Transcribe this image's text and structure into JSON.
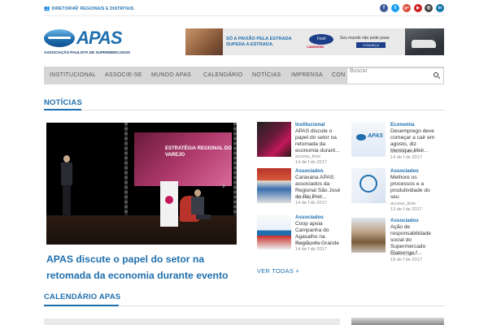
{
  "topbar": {
    "links": [
      {
        "label": "DIRETORIA",
        "icon": "people-icon"
      },
      {
        "label": "REGIONAIS E DISTRITAIS",
        "icon": "pin-icon"
      }
    ],
    "social": [
      {
        "glyph": "f",
        "icon": "facebook-icon",
        "color": "#3b5998"
      },
      {
        "glyph": "t",
        "icon": "twitter-icon",
        "color": "#1da1f2"
      },
      {
        "glyph": "g+",
        "icon": "googleplus-icon",
        "color": "#dd4b39"
      },
      {
        "glyph": "▶",
        "icon": "youtube-icon",
        "color": "#cd201f"
      },
      {
        "glyph": "◎",
        "icon": "instagram-icon",
        "color": "#3f3f3f"
      },
      {
        "glyph": "in",
        "icon": "linkedin-icon",
        "color": "#0e76a8"
      }
    ]
  },
  "logo": {
    "word": "APAS",
    "subtitle": "ASSOCIAÇÃO PAULISTA DE SUPERMERCADOS"
  },
  "banner": {
    "slogan": "SÓ A PAIXÃO PELA ESTRADA SUPERA A ESTRADA.",
    "ford": "Ford",
    "brand": "CAMINHÕES",
    "tagline": "Seu mundo não pode parar",
    "cta": "CONHEÇA"
  },
  "nav": {
    "items": [
      "INSTITUCIONAL",
      "ASSOCIE-SE",
      "MUNDO APAS",
      "CALENDÁRIO",
      "NOTÍCIAS",
      "IMPRENSA",
      "CON"
    ],
    "search_placeholder": "Buscar"
  },
  "noticias": {
    "heading": "NOTÍCIAS",
    "hero_title": "APAS discute o papel do setor na retomada da economia durante evento em Bauru",
    "hero_screen_text": "ESTRATÉGIA REGIONAL DO VAREJO",
    "items": [
      {
        "category": "Institucional",
        "title": "APAS discute o papel do setor na retomada da economia durant...",
        "author": "access_time",
        "date": "14 de f de 2017"
      },
      {
        "category": "Economia",
        "title": "Desemprego deve começar a cair em agosto, diz Henrique Meir...",
        "author": "access_time",
        "date": "14 de f de 2017"
      },
      {
        "category": "Associados",
        "title": "Caravana APAS: associados da Regional São José do Rio Pret...",
        "author": "access_time",
        "date": "14 de f de 2017"
      },
      {
        "category": "Associados",
        "title": "Melhore os processos e a produtividade do seu supermercado...",
        "author": "access_time",
        "date": "13 de f de 2017"
      },
      {
        "category": "Associados",
        "title": "Coop apoia Campanha do Agasalho na Região do Grande ABC...",
        "author": "access_time",
        "date": "14 de f de 2017"
      },
      {
        "category": "Associados",
        "title": "Ação de responsabilidade social do Supermercado Flamengo f...",
        "author": "access_time",
        "date": "19 de f de 2017"
      }
    ],
    "ver_todas": "VER TODAS +"
  },
  "calendario": {
    "heading": "CALENDÁRIO APAS"
  }
}
